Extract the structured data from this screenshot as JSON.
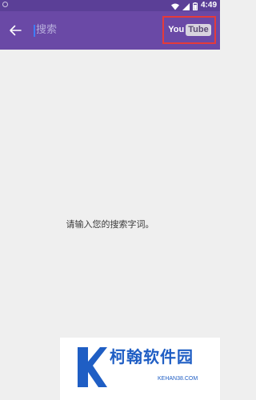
{
  "status_bar": {
    "time": "4:49",
    "icons": [
      "wifi-icon",
      "signal-icon",
      "battery-icon"
    ]
  },
  "app_bar": {
    "back_icon": "arrow-left-icon",
    "search_placeholder": "搜索",
    "brand": {
      "you": "You",
      "tube": "Tube",
      "highlight_color": "#e53a3a"
    },
    "background_color": "#6a49a6"
  },
  "content": {
    "empty_message": "请输入您的搜索字词。"
  },
  "watermark": {
    "title": "柯翰软件园",
    "domain": "KEHAN38.COM",
    "color": "#1f5ec4"
  }
}
